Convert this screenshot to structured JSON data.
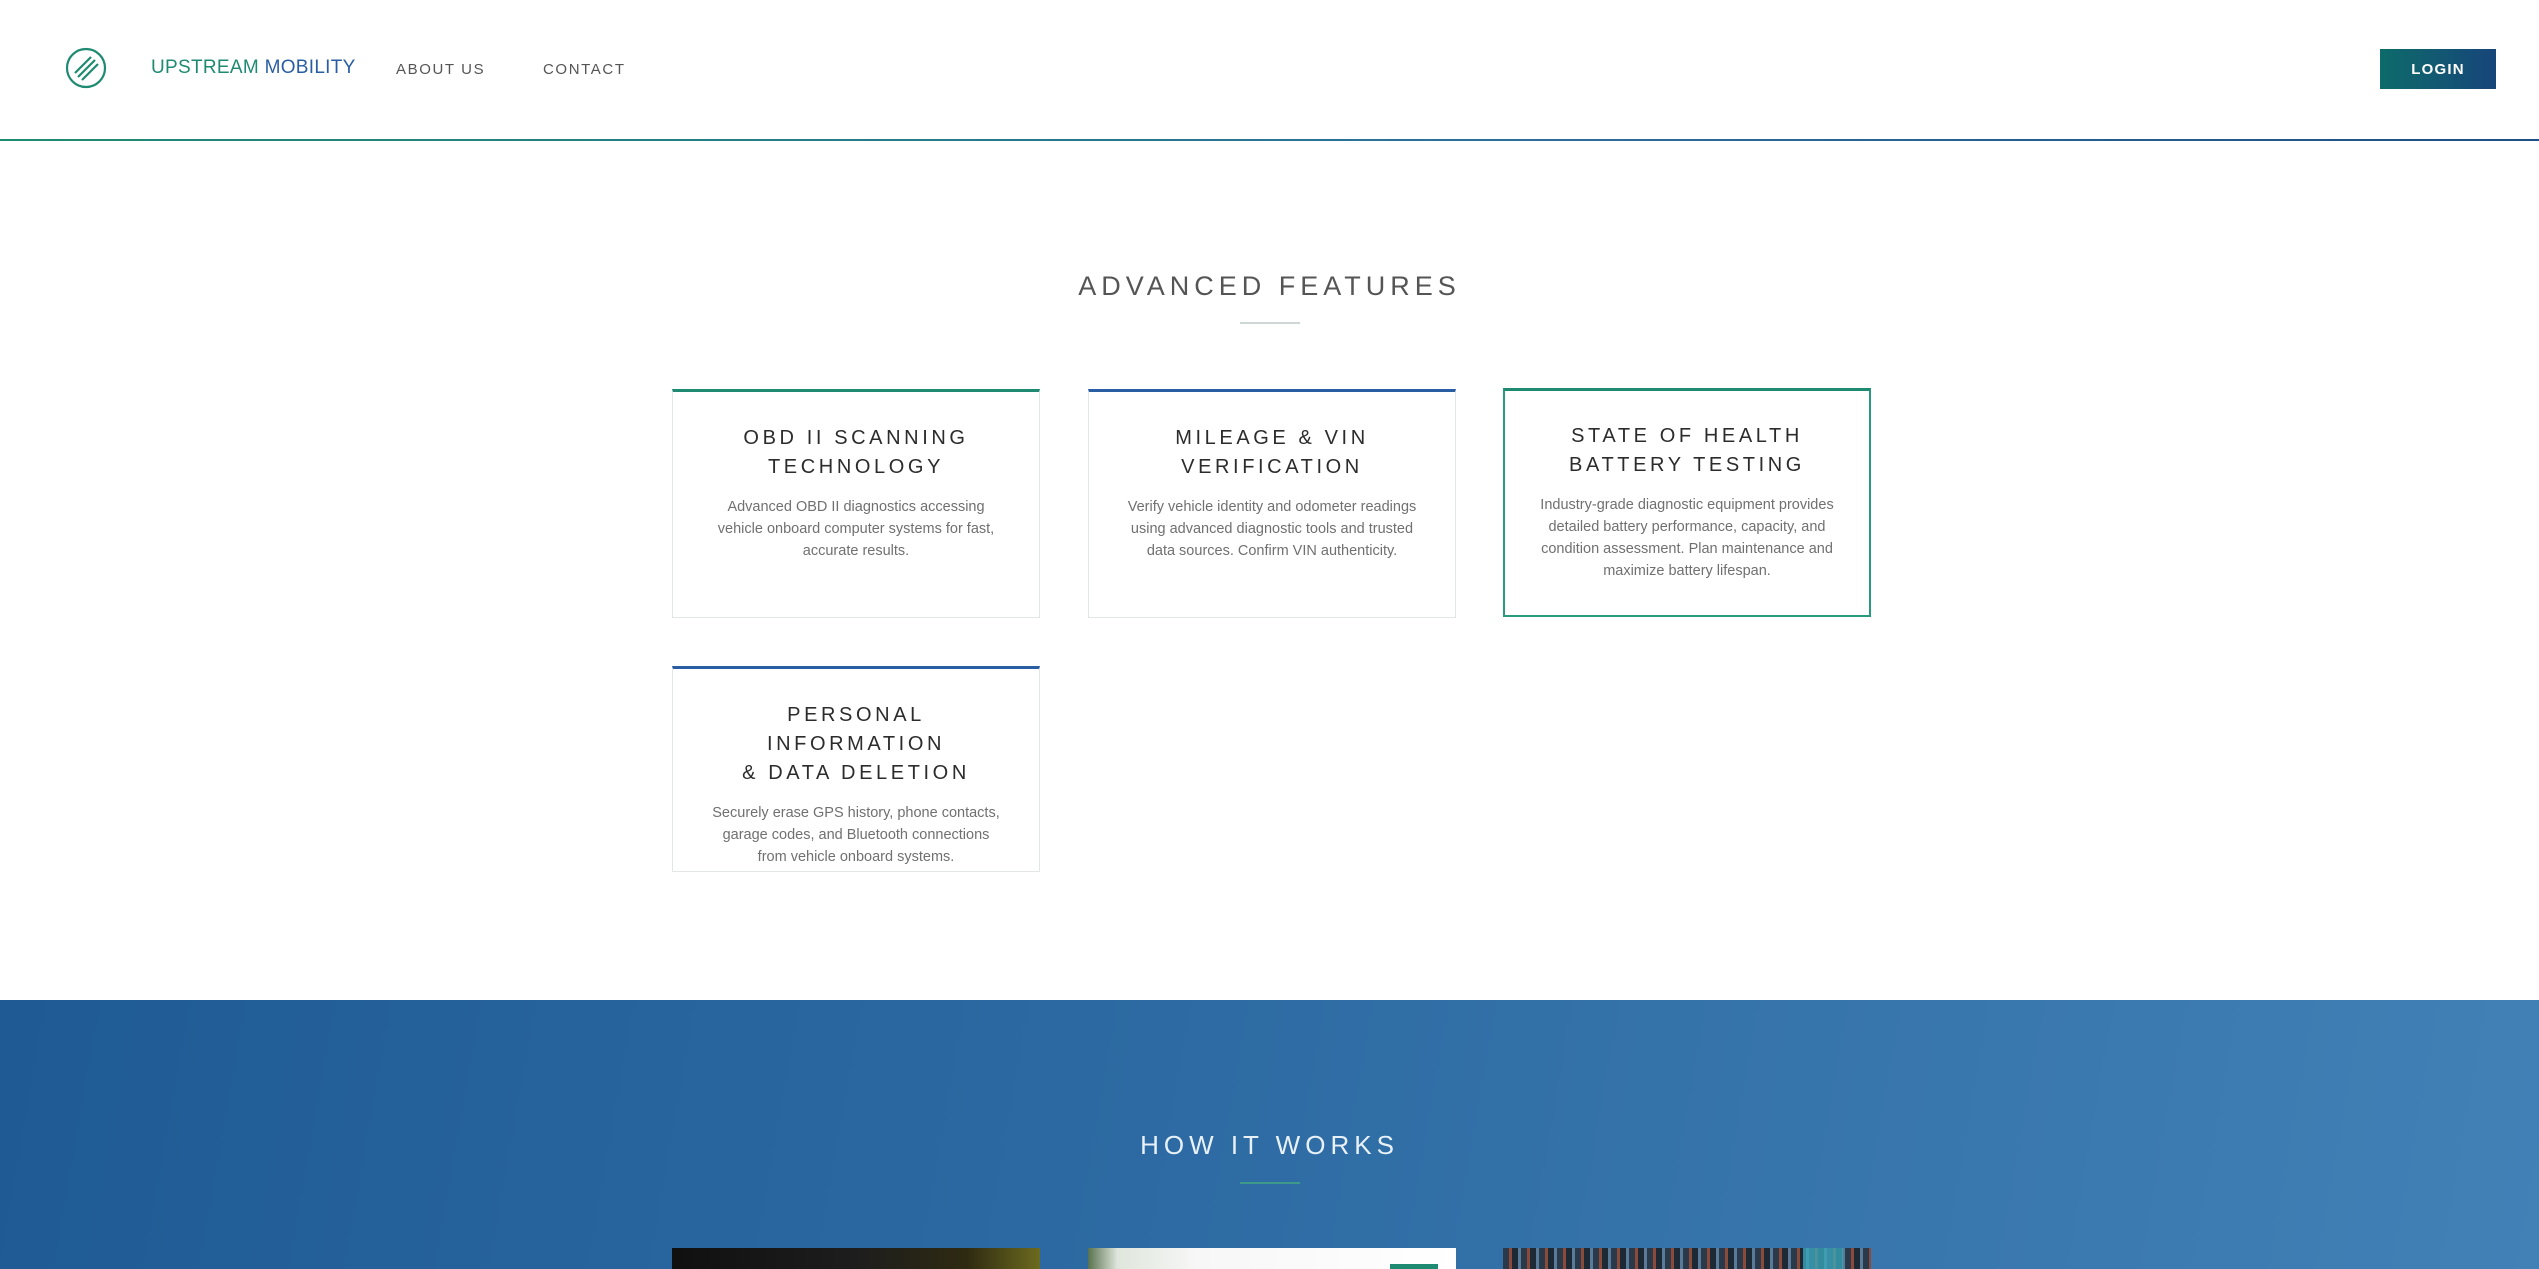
{
  "header": {
    "brand_part1": "UPSTREAM",
    "brand_part2": "MOBILITY",
    "nav": {
      "about": "ABOUT US",
      "contact": "CONTACT"
    },
    "login_label": "LOGIN"
  },
  "features": {
    "title": "ADVANCED FEATURES",
    "cards": [
      {
        "title_line1": "OBD II SCANNING",
        "title_line2": "TECHNOLOGY",
        "desc_line1": "Advanced OBD II diagnostics accessing",
        "desc_line2": "vehicle onboard computer systems for fast,",
        "desc_line3": "accurate results."
      },
      {
        "title_line1": "MILEAGE & VIN",
        "title_line2": "VERIFICATION",
        "desc_line1": "Verify vehicle identity and odometer readings",
        "desc_line2": "using advanced diagnostic tools and trusted",
        "desc_line3": "data sources. Confirm VIN authenticity."
      },
      {
        "title_line1": "STATE OF HEALTH",
        "title_line2": "BATTERY TESTING",
        "desc_line1": "Industry-grade diagnostic equipment provides",
        "desc_line2": "detailed battery performance, capacity, and",
        "desc_line3": "condition assessment. Plan maintenance and",
        "desc_line4": "maximize battery lifespan."
      },
      {
        "title_line1": "PERSONAL INFORMATION",
        "title_line2": "& DATA DELETION",
        "desc_line1": "Securely erase GPS history, phone contacts,",
        "desc_line2": "garage codes, and Bluetooth connections",
        "desc_line3": "from vehicle onboard systems."
      }
    ]
  },
  "how_it_works": {
    "title": "HOW IT WORKS"
  },
  "colors": {
    "brand_green": "#1f8a72",
    "brand_blue": "#2a5ea3",
    "section_blue": "#2d6aa3"
  }
}
